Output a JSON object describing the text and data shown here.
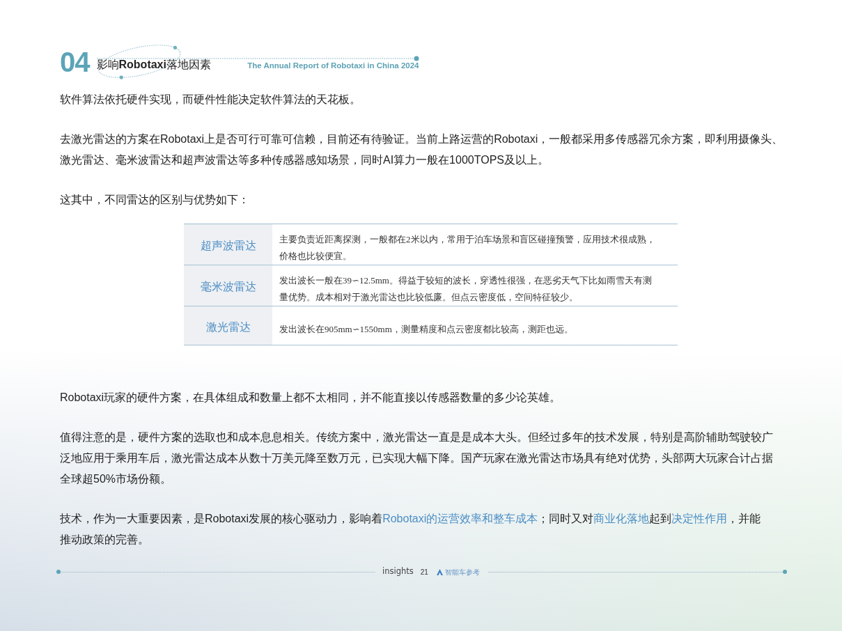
{
  "header": {
    "section_number": "04",
    "title": "影响**Robotaxi**落地因素",
    "subtitle": "The Annual Report of Robotaxi in China 2024"
  },
  "content": [
    {
      "kind": "paragraph",
      "lines": [
        [
          {
            "text": "软件算法依托硬件实现，而硬件性能决定软件算法的天花板。",
            "highlight": false
          }
        ]
      ]
    },
    {
      "kind": "paragraph",
      "lines": [
        [
          {
            "text": "去激光雷达的方案在Robotaxi上是否可行可靠可信赖，目前还有待验证。当前上路运营的Robotaxi，一般都采用多传感器冗余方案，即利用摄像头、",
            "highlight": false
          }
        ],
        [
          {
            "text": "激光雷达、毫米波雷达和超声波雷达等多种传感器感知场景，同时AI算力一般在1000TOPS及以上。",
            "highlight": false
          }
        ]
      ]
    },
    {
      "kind": "paragraph",
      "lines": [
        [
          {
            "text": "这其中，不同雷达的区别与优势如下：",
            "highlight": false
          }
        ]
      ]
    },
    {
      "kind": "table",
      "rows": [
        {
          "label": "超声波雷达",
          "lines": [
            "主要负责近距离探测，一般都在2米以内，常用于泊车场景和盲区碰撞预警，应用技术很成熟，",
            "价格也比较便宜。"
          ]
        },
        {
          "label": "毫米波雷达",
          "lines": [
            "发出波长一般在39∽12.5mm。得益于较短的波长，穿透性很强，在恶劣天气下比如雨雪天有测",
            "量优势。成本相对于激光雷达也比较低廉。但点云密度低，空间特征较少。"
          ]
        },
        {
          "label": "激光雷达",
          "lines": [
            "发出波长在905mm∽1550mm，测量精度和点云密度都比较高，测距也远。"
          ]
        }
      ]
    },
    {
      "kind": "paragraph",
      "lines": [
        [
          {
            "text": "Robotaxi玩家的硬件方案，在具体组成和数量上都不太相同，并不能直接以传感器数量的多少论英雄。",
            "highlight": false
          }
        ]
      ]
    },
    {
      "kind": "paragraph",
      "lines": [
        [
          {
            "text": "值得注意的是，硬件方案的选取也和成本息息相关。传统方案中，激光雷达一直是是成本大头。但经过多年的技术发展，特别是高阶辅助驾驶较广",
            "highlight": false
          }
        ],
        [
          {
            "text": "泛地应用于乘用车后，激光雷达成本从数十万美元降至数万元，已实现大幅下降。国产玩家在激光雷达市场具有绝对优势，头部两大玩家合计占据",
            "highlight": false
          }
        ],
        [
          {
            "text": "全球超50%市场份额。",
            "highlight": false
          }
        ]
      ]
    },
    {
      "kind": "paragraph",
      "lines": [
        [
          {
            "text": "技术，作为一大重要因素，是Robotaxi发展的核心驱动力，影响着",
            "highlight": false
          },
          {
            "text": "Robotaxi的运营效率和整车成本",
            "highlight": true
          },
          {
            "text": "；同时又对",
            "highlight": false
          },
          {
            "text": "商业化落地",
            "highlight": true
          },
          {
            "text": "起到",
            "highlight": false
          },
          {
            "text": "决定性作用",
            "highlight": true
          },
          {
            "text": "，并能",
            "highlight": false
          }
        ],
        [
          {
            "text": "推动政策的完善。",
            "highlight": false
          }
        ]
      ]
    }
  ],
  "footer": {
    "brand": "insights",
    "page_number": "21",
    "publisher": "智能车参考"
  }
}
